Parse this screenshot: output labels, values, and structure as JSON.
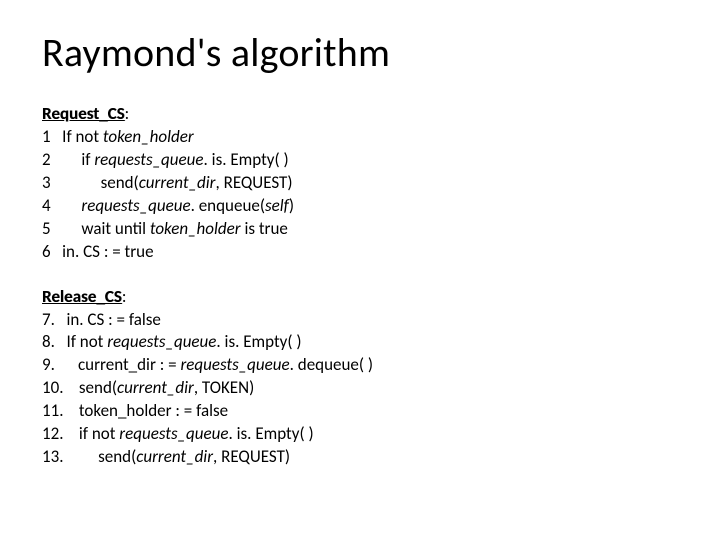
{
  "title": "Raymond's algorithm",
  "request": {
    "heading": "Request_CS",
    "lines": [
      {
        "n": "1",
        "pad": "   ",
        "html": "If not <i>token_holder</i>"
      },
      {
        "n": "2",
        "pad": "        ",
        "html": "if <i>requests_queue</i>. is. Empty( )"
      },
      {
        "n": "3",
        "pad": "             ",
        "html": "send(<i>current_dir</i>, REQUEST)"
      },
      {
        "n": "4",
        "pad": "        ",
        "html": "<i>requests_queue</i>. enqueue(<i>self</i>)"
      },
      {
        "n": "5",
        "pad": "        ",
        "html": "wait until <i>token_holder</i> is true"
      },
      {
        "n": "6",
        "pad": "   ",
        "html": "in. CS : = true"
      }
    ]
  },
  "release": {
    "heading": "Release_CS",
    "lines": [
      {
        "n": "7.",
        "pad": "   ",
        "html": "in. CS : = false"
      },
      {
        "n": "8.",
        "pad": "   ",
        "html": "If not <i>requests_queue</i>. is. Empty( )"
      },
      {
        "n": "9.",
        "pad": "      ",
        "html": "current_dir : = <i>requests_queue</i>. dequeue( )"
      },
      {
        "n": "10.",
        "pad": "    ",
        "html": "send(<i>current_dir</i>, TOKEN)"
      },
      {
        "n": "11.",
        "pad": "    ",
        "html": "token_holder : = false"
      },
      {
        "n": "12.",
        "pad": "    ",
        "html": "if not <i>requests_queue</i>. is. Empty( )"
      },
      {
        "n": "13.",
        "pad": "         ",
        "html": "send(<i>current_dir</i>, REQUEST)"
      }
    ]
  }
}
